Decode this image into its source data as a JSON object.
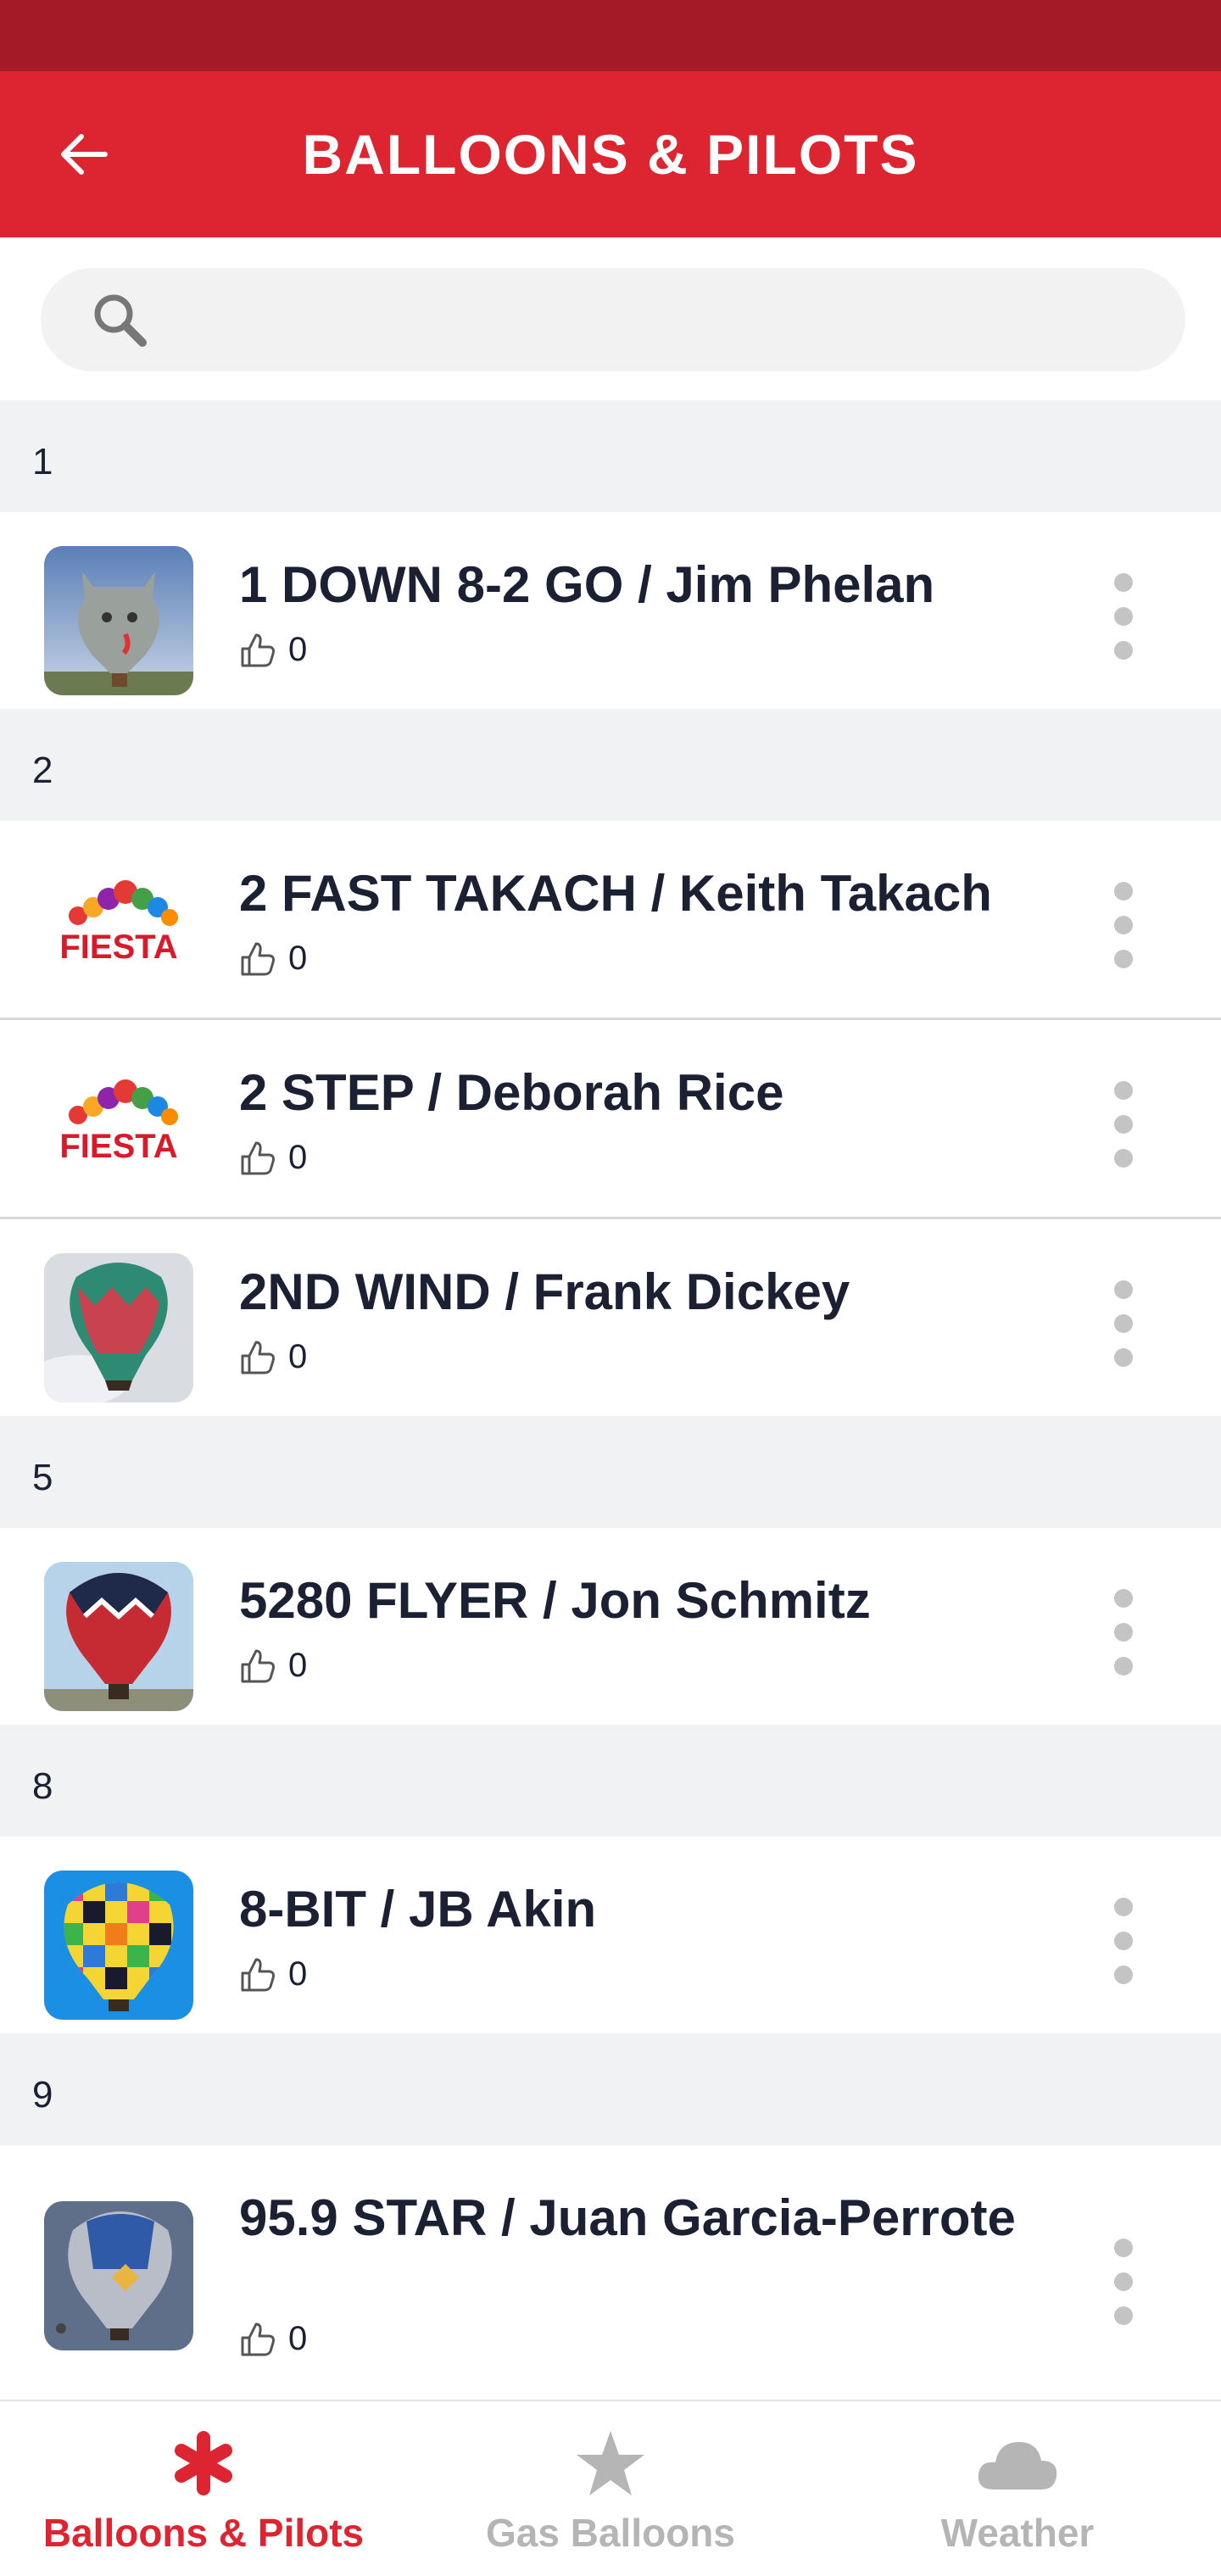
{
  "header": {
    "title": "BALLOONS & PILOTS"
  },
  "search": {
    "value": "",
    "placeholder": ""
  },
  "sections": [
    {
      "letter": "1",
      "items": [
        {
          "name": "1 DOWN 8-2 GO / Jim Phelan",
          "likes": "0",
          "thumb": "cat-balloon-photo"
        }
      ]
    },
    {
      "letter": "2",
      "items": [
        {
          "name": "2 FAST TAKACH / Keith Takach",
          "likes": "0",
          "thumb": "fiesta-logo"
        },
        {
          "name": "2 STEP / Deborah Rice",
          "likes": "0",
          "thumb": "fiesta-logo"
        },
        {
          "name": "2ND WIND / Frank Dickey",
          "likes": "0",
          "thumb": "red-green-balloon-photo"
        }
      ]
    },
    {
      "letter": "5",
      "items": [
        {
          "name": "5280 FLYER / Jon Schmitz",
          "likes": "0",
          "thumb": "red-blue-balloon-photo"
        }
      ]
    },
    {
      "letter": "8",
      "items": [
        {
          "name": "8-BIT / JB Akin",
          "likes": "0",
          "thumb": "pixel-balloon-photo"
        }
      ]
    },
    {
      "letter": "9",
      "items": [
        {
          "name": "95.9 STAR / Juan Garcia-Perrote",
          "likes": "0",
          "thumb": "star-balloon-photo"
        }
      ]
    }
  ],
  "fiesta_logo_text": "FIESTA",
  "nav": [
    {
      "label": "Balloons & Pilots",
      "icon": "asterisk-icon",
      "active": true
    },
    {
      "label": "Gas Balloons",
      "icon": "star-icon",
      "active": false
    },
    {
      "label": "Weather",
      "icon": "cloud-icon",
      "active": false
    }
  ],
  "colors": {
    "brand_red": "#dd2532",
    "status_red": "#a31b26",
    "inactive": "#b5b5b5",
    "text": "#1b2133"
  }
}
